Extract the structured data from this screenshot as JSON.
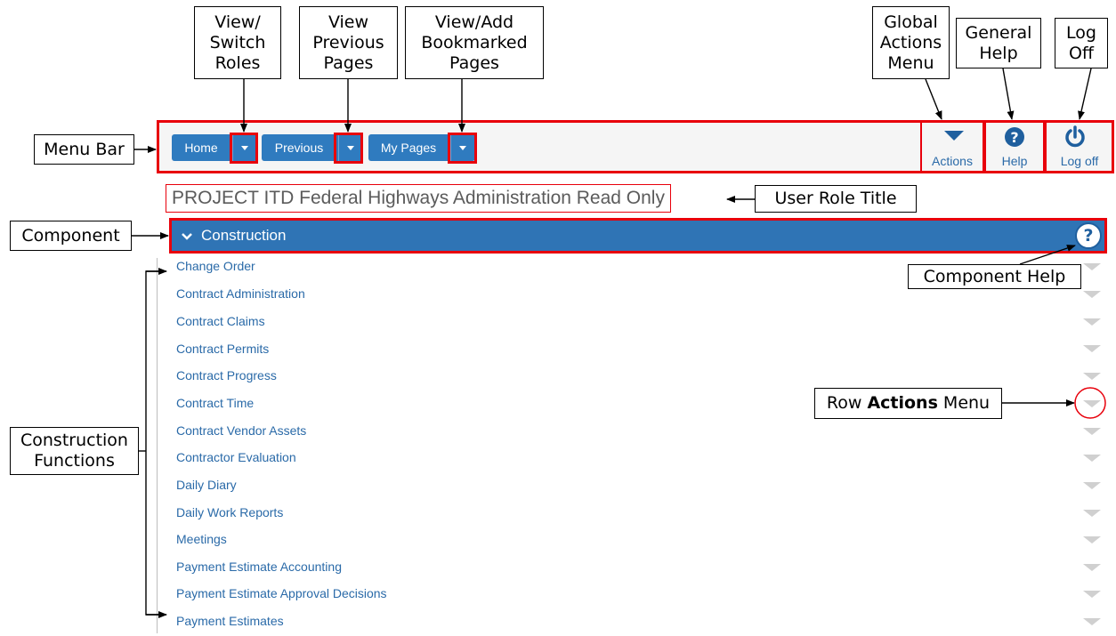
{
  "callouts": {
    "switch_roles": "View/\nSwitch\nRoles",
    "previous_pages": "View\nPrevious\nPages",
    "bookmarked_pages": "View/Add\nBookmarked\nPages",
    "global_actions": "Global\nActions\nMenu",
    "general_help": "General\nHelp",
    "log_off": "Log\nOff",
    "menu_bar": "Menu Bar",
    "user_role_title": "User Role Title",
    "component": "Component",
    "component_help": "Component Help",
    "row_actions_prefix": "Row ",
    "row_actions_bold": "Actions",
    "row_actions_suffix": " Menu",
    "construction_functions": "Construction\nFunctions"
  },
  "menu": {
    "home": "Home",
    "previous": "Previous",
    "my_pages": "My Pages",
    "actions": "Actions",
    "help": "Help",
    "log_off": "Log off"
  },
  "role_title": "PROJECT ITD Federal Highways Administration Read Only",
  "component": {
    "title": "Construction",
    "help_glyph": "?"
  },
  "functions": [
    "Change Order",
    "Contract Administration",
    "Contract Claims",
    "Contract Permits",
    "Contract Progress",
    "Contract Time",
    "Contract Vendor Assets",
    "Contractor Evaluation",
    "Daily Diary",
    "Daily Work Reports",
    "Meetings",
    "Payment Estimate Accounting",
    "Payment Estimate Approval Decisions",
    "Payment Estimates"
  ],
  "colors": {
    "accent": "#2f7bbf",
    "header": "#2f74b5",
    "highlight": "#e8000b",
    "link": "#2a6aa8"
  },
  "icons": [
    "caret-down-icon",
    "help-circle-icon",
    "power-icon",
    "chevron-down-icon"
  ]
}
